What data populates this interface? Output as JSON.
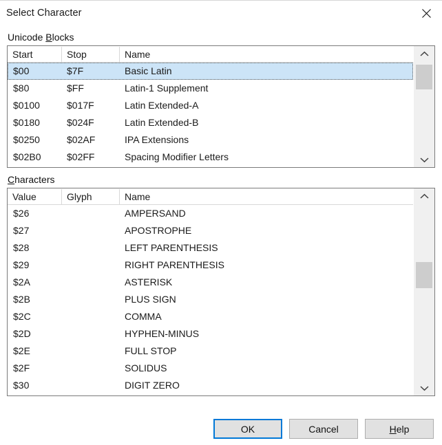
{
  "window": {
    "title": "Select Character",
    "close_icon": "close-icon"
  },
  "unicode_blocks": {
    "label": "Unicode Blocks",
    "mnemonic": "B",
    "label_before": "Unicode ",
    "label_after": "locks",
    "columns": [
      "Start",
      "Stop",
      "Name"
    ],
    "rows": [
      {
        "start": "$00",
        "stop": "$7F",
        "name": "Basic Latin",
        "selected": true
      },
      {
        "start": "$80",
        "stop": "$FF",
        "name": "Latin-1 Supplement",
        "selected": false
      },
      {
        "start": "$0100",
        "stop": "$017F",
        "name": "Latin Extended-A",
        "selected": false
      },
      {
        "start": "$0180",
        "stop": "$024F",
        "name": "Latin Extended-B",
        "selected": false
      },
      {
        "start": "$0250",
        "stop": "$02AF",
        "name": "IPA Extensions",
        "selected": false
      },
      {
        "start": "$02B0",
        "stop": "$02FF",
        "name": "Spacing Modifier Letters",
        "selected": false
      }
    ],
    "scrollbar": {
      "up_icon": "chevron-up-icon",
      "down_icon": "chevron-down-icon",
      "thumb_top_pct": 4,
      "thumb_height_pct": 27
    }
  },
  "characters": {
    "label": "Characters",
    "mnemonic": "C",
    "label_before": "",
    "label_after": "haracters",
    "columns": [
      "Value",
      "Glyph",
      "Name"
    ],
    "rows": [
      {
        "value": "$26",
        "glyph": "",
        "name": "AMPERSAND",
        "selected": false
      },
      {
        "value": "$27",
        "glyph": "",
        "name": "APOSTROPHE",
        "selected": false
      },
      {
        "value": "$28",
        "glyph": "",
        "name": "LEFT PARENTHESIS",
        "selected": false
      },
      {
        "value": "$29",
        "glyph": "",
        "name": "RIGHT PARENTHESIS",
        "selected": false
      },
      {
        "value": "$2A",
        "glyph": "",
        "name": "ASTERISK",
        "selected": false
      },
      {
        "value": "$2B",
        "glyph": "",
        "name": "PLUS SIGN",
        "selected": false
      },
      {
        "value": "$2C",
        "glyph": "",
        "name": "COMMA",
        "selected": false
      },
      {
        "value": "$2D",
        "glyph": "",
        "name": "HYPHEN-MINUS",
        "selected": false
      },
      {
        "value": "$2E",
        "glyph": "",
        "name": "FULL STOP",
        "selected": false
      },
      {
        "value": "$2F",
        "glyph": "",
        "name": "SOLIDUS",
        "selected": false
      },
      {
        "value": "$30",
        "glyph": "",
        "name": "DIGIT ZERO",
        "selected": false
      }
    ],
    "scrollbar": {
      "up_icon": "chevron-up-icon",
      "down_icon": "chevron-down-icon",
      "thumb_top_pct": 33,
      "thumb_height_pct": 15
    }
  },
  "buttons": {
    "ok": "OK",
    "cancel": "Cancel",
    "help_before": "",
    "help_mnemonic": "H",
    "help_after": "elp"
  },
  "colors": {
    "selection": "#cce4f7",
    "focus_border": "#0078d7",
    "button_face": "#e1e1e1",
    "scrollbar_track": "#f0f0f0",
    "scrollbar_thumb": "#cdcdcd"
  }
}
